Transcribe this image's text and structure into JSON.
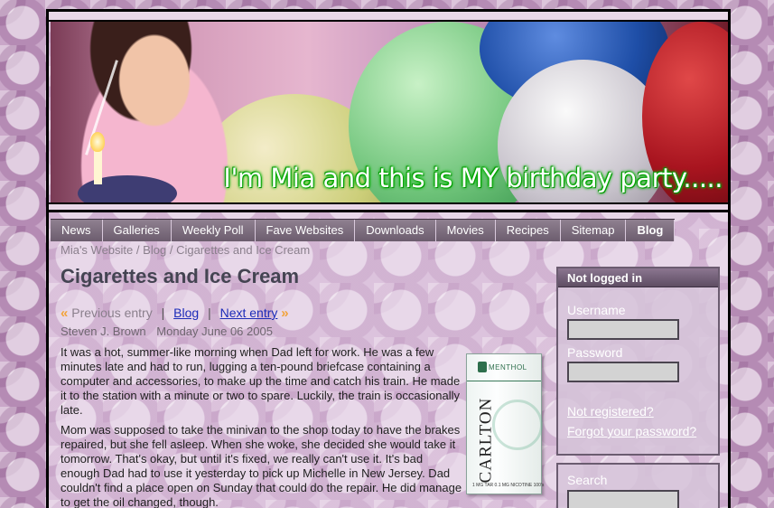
{
  "banner": {
    "text": "I'm Mia and this is MY birthday party....."
  },
  "nav": {
    "items": [
      {
        "label": "News"
      },
      {
        "label": "Galleries"
      },
      {
        "label": "Weekly Poll"
      },
      {
        "label": "Fave Websites"
      },
      {
        "label": "Downloads"
      },
      {
        "label": "Movies"
      },
      {
        "label": "Recipes"
      },
      {
        "label": "Sitemap"
      },
      {
        "label": "Blog",
        "active": true
      }
    ]
  },
  "breadcrumb": {
    "home": "Mia's Website",
    "section": "Blog",
    "current": "Cigarettes and Ice Cream",
    "separator": "/"
  },
  "post": {
    "title": "Cigarettes and Ice Cream",
    "prev_label": "Previous entry",
    "blog_label": "Blog",
    "next_label": "Next entry",
    "prev_arrow": "«",
    "next_arrow": "»",
    "divider": "|",
    "author": "Steven J. Brown",
    "date": "Monday June 06 2005",
    "paragraphs": [
      "It was a hot, summer-like morning when Dad left for work. He was a few minutes late and had to run, lugging a ten-pound briefcase containing a computer and accessories, to make up the time and catch his train. He made it to the station with a minute or two to spare. Luckily, the train is occasionally late.",
      "Mom was supposed to take the minivan to the shop today to have the brakes repaired, but she fell asleep. When she woke, she decided she would take it tomorrow. That's okay, but until it's fixed, we really can't use it. It's bad enough Dad had to use it yesterday to pick up Michelle in New Jersey. Dad couldn't find a place open on Sunday that could do the repair. He did manage to get the oil changed, though."
    ],
    "image": {
      "brand": "CARLTON",
      "variant": "MENTHOL",
      "fine_print": "1 MG TAR 0.1 MG NICOTINE 100's"
    }
  },
  "login": {
    "heading": "Not logged in",
    "username_label": "Username",
    "username_value": "",
    "password_label": "Password",
    "password_value": "",
    "register_link": "Not registered?",
    "forgot_link": "Forgot your password?"
  },
  "search": {
    "label": "Search",
    "value": ""
  }
}
